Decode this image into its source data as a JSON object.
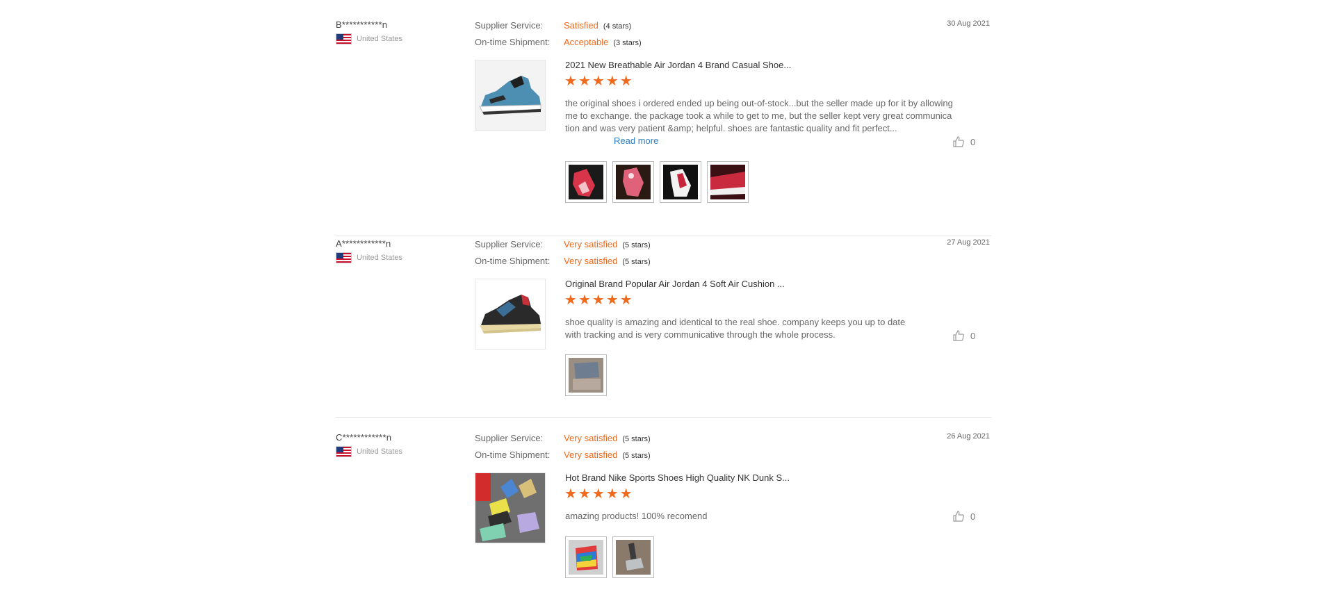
{
  "reviews": [
    {
      "reviewer": "B***********n",
      "country": "United States",
      "date": "30 Aug 2021",
      "supplier_service_label": "Supplier Service:",
      "supplier_service_value": "Satisfied",
      "supplier_service_stars": "(4 stars)",
      "shipment_label": "On-time Shipment:",
      "shipment_value": "Acceptable",
      "shipment_stars": "(3 stars)",
      "product_title": "2021 New Breathable Air Jordan 4 Brand Casual Shoe...",
      "product_rating": 5,
      "text": "the original shoes i ordered ended up being out-of-stock...but the seller made up for it by allowing me to exchange. the package took a while to get to me, but the seller kept very great communication and was very patient &amp; helpful. shoes are fantastic quality and fit perfect...",
      "read_more": "Read more",
      "helpful_count": "0"
    },
    {
      "reviewer": "A************n",
      "country": "United States",
      "date": "27 Aug 2021",
      "supplier_service_label": "Supplier Service:",
      "supplier_service_value": "Very satisfied",
      "supplier_service_stars": "(5 stars)",
      "shipment_label": "On-time Shipment:",
      "shipment_value": "Very satisfied",
      "shipment_stars": "(5 stars)",
      "product_title": "Original Brand Popular Air Jordan 4 Soft Air Cushion ...",
      "product_rating": 5,
      "text": "shoe quality is amazing and identical to the real shoe. company keeps you up to date with tracking and is very communicative through the whole process.",
      "helpful_count": "0"
    },
    {
      "reviewer": "C************n",
      "country": "United States",
      "date": "26 Aug 2021",
      "supplier_service_label": "Supplier Service:",
      "supplier_service_value": "Very satisfied",
      "supplier_service_stars": "(5 stars)",
      "shipment_label": "On-time Shipment:",
      "shipment_value": "Very satisfied",
      "shipment_stars": "(5 stars)",
      "product_title": "Hot Brand Nike Sports Shoes High Quality NK Dunk S...",
      "product_rating": 5,
      "text": "amazing products! 100% recomend",
      "helpful_count": "0"
    }
  ]
}
